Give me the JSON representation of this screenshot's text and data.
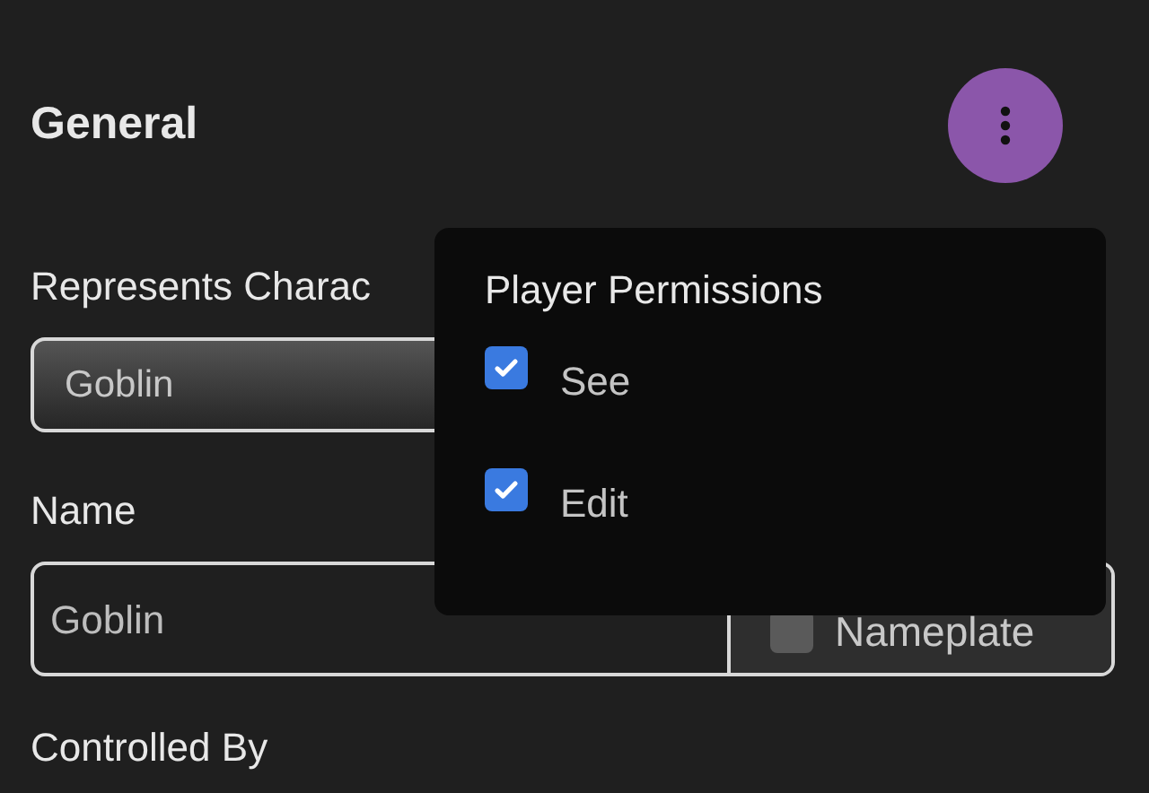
{
  "title": "General",
  "fields": [
    {
      "label": "Represents Charac",
      "value": "Goblin"
    },
    {
      "label": "Name",
      "value": "Goblin",
      "nameplate": {
        "label": "Nameplate",
        "checked": false
      }
    }
  ],
  "controlled_by": {
    "label": "Controlled By"
  },
  "popover": {
    "title": "Player Permissions",
    "options": [
      {
        "label": "See",
        "checked": true
      },
      {
        "label": "Edit",
        "checked": true
      }
    ]
  }
}
